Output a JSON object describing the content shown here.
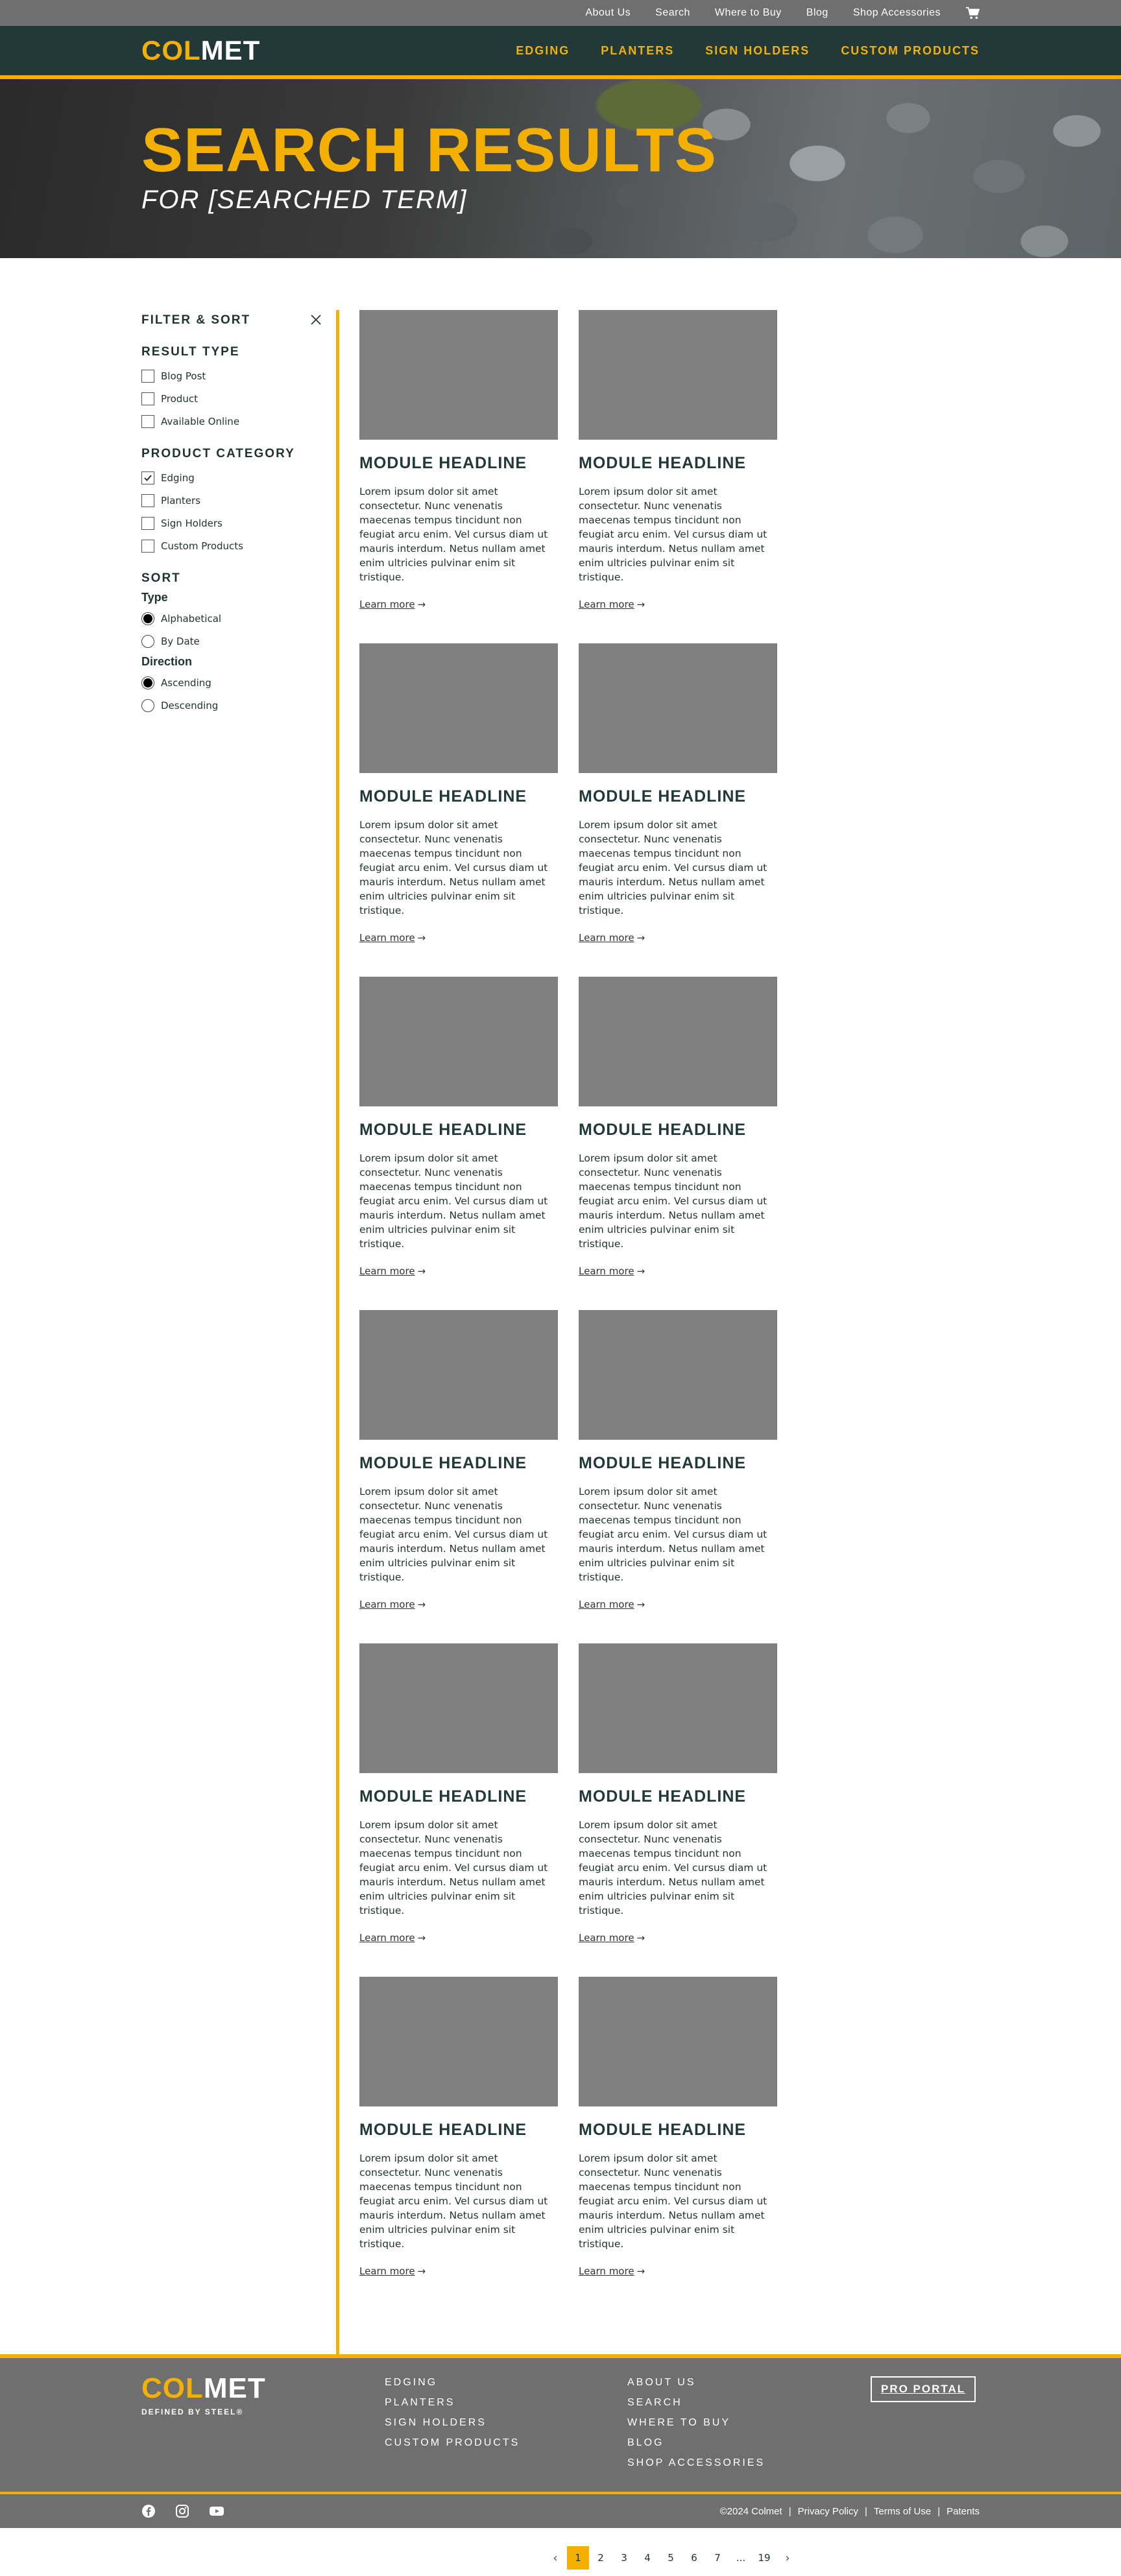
{
  "utility_nav": [
    "About Us",
    "Search",
    "Where to Buy",
    "Blog",
    "Shop Accessories"
  ],
  "brand": {
    "logo_part1": "COL",
    "logo_part2": "MET",
    "tagline": "DEFINED BY STEEL®"
  },
  "main_nav": [
    "EDGING",
    "PLANTERS",
    "SIGN HOLDERS",
    "CUSTOM PRODUCTS"
  ],
  "hero": {
    "title": "SEARCH RESULTS",
    "subtitle": "FOR [SEARCHED TERM]"
  },
  "filters": {
    "title": "FILTER & SORT",
    "result_type": {
      "title": "RESULT TYPE",
      "options": [
        {
          "label": "Blog Post",
          "checked": false
        },
        {
          "label": "Product",
          "checked": false
        },
        {
          "label": "Available Online",
          "checked": false
        }
      ]
    },
    "product_category": {
      "title": "PRODUCT CATEGORY",
      "options": [
        {
          "label": "Edging",
          "checked": true
        },
        {
          "label": "Planters",
          "checked": false
        },
        {
          "label": "Sign Holders",
          "checked": false
        },
        {
          "label": "Custom Products",
          "checked": false
        }
      ]
    },
    "sort": {
      "title": "SORT",
      "type_label": "Type",
      "type_options": [
        {
          "label": "Alphabetical",
          "selected": true
        },
        {
          "label": "By Date",
          "selected": false
        }
      ],
      "direction_label": "Direction",
      "direction_options": [
        {
          "label": "Ascending",
          "selected": true
        },
        {
          "label": "Descending",
          "selected": false
        }
      ]
    }
  },
  "results": [
    {
      "headline": "MODULE HEADLINE",
      "body": "Lorem ipsum dolor sit amet consectetur. Nunc venenatis maecenas tempus tincidunt non feugiat arcu enim. Vel cursus diam ut mauris interdum. Netus nullam amet enim ultricies pulvinar enim sit tristique.",
      "link": "Learn more"
    },
    {
      "headline": "MODULE HEADLINE",
      "body": "Lorem ipsum dolor sit amet consectetur. Nunc venenatis maecenas tempus tincidunt non feugiat arcu enim. Vel cursus diam ut mauris interdum. Netus nullam amet enim ultricies pulvinar enim sit tristique.",
      "link": "Learn more"
    },
    {
      "headline": "MODULE HEADLINE",
      "body": "Lorem ipsum dolor sit amet consectetur. Nunc venenatis maecenas tempus tincidunt non feugiat arcu enim. Vel cursus diam ut mauris interdum. Netus nullam amet enim ultricies pulvinar enim sit tristique.",
      "link": "Learn more"
    },
    {
      "headline": "MODULE HEADLINE",
      "body": "Lorem ipsum dolor sit amet consectetur. Nunc venenatis maecenas tempus tincidunt non feugiat arcu enim. Vel cursus diam ut mauris interdum. Netus nullam amet enim ultricies pulvinar enim sit tristique.",
      "link": "Learn more"
    },
    {
      "headline": "MODULE HEADLINE",
      "body": "Lorem ipsum dolor sit amet consectetur. Nunc venenatis maecenas tempus tincidunt non feugiat arcu enim. Vel cursus diam ut mauris interdum. Netus nullam amet enim ultricies pulvinar enim sit tristique.",
      "link": "Learn more"
    },
    {
      "headline": "MODULE HEADLINE",
      "body": "Lorem ipsum dolor sit amet consectetur. Nunc venenatis maecenas tempus tincidunt non feugiat arcu enim. Vel cursus diam ut mauris interdum. Netus nullam amet enim ultricies pulvinar enim sit tristique.",
      "link": "Learn more"
    },
    {
      "headline": "MODULE HEADLINE",
      "body": "Lorem ipsum dolor sit amet consectetur. Nunc venenatis maecenas tempus tincidunt non feugiat arcu enim. Vel cursus diam ut mauris interdum. Netus nullam amet enim ultricies pulvinar enim sit tristique.",
      "link": "Learn more"
    },
    {
      "headline": "MODULE HEADLINE",
      "body": "Lorem ipsum dolor sit amet consectetur. Nunc venenatis maecenas tempus tincidunt non feugiat arcu enim. Vel cursus diam ut mauris interdum. Netus nullam amet enim ultricies pulvinar enim sit tristique.",
      "link": "Learn more"
    },
    {
      "headline": "MODULE HEADLINE",
      "body": "Lorem ipsum dolor sit amet consectetur. Nunc venenatis maecenas tempus tincidunt non feugiat arcu enim. Vel cursus diam ut mauris interdum. Netus nullam amet enim ultricies pulvinar enim sit tristique.",
      "link": "Learn more"
    },
    {
      "headline": "MODULE HEADLINE",
      "body": "Lorem ipsum dolor sit amet consectetur. Nunc venenatis maecenas tempus tincidunt non feugiat arcu enim. Vel cursus diam ut mauris interdum. Netus nullam amet enim ultricies pulvinar enim sit tristique.",
      "link": "Learn more"
    },
    {
      "headline": "MODULE HEADLINE",
      "body": "Lorem ipsum dolor sit amet consectetur. Nunc venenatis maecenas tempus tincidunt non feugiat arcu enim. Vel cursus diam ut mauris interdum. Netus nullam amet enim ultricies pulvinar enim sit tristique.",
      "link": "Learn more"
    },
    {
      "headline": "MODULE HEADLINE",
      "body": "Lorem ipsum dolor sit amet consectetur. Nunc venenatis maecenas tempus tincidunt non feugiat arcu enim. Vel cursus diam ut mauris interdum. Netus nullam amet enim ultricies pulvinar enim sit tristique.",
      "link": "Learn more"
    }
  ],
  "pagination": {
    "pages": [
      "1",
      "2",
      "3",
      "4",
      "5",
      "6",
      "7",
      "...",
      "19"
    ],
    "current": "1"
  },
  "footer": {
    "col1": [
      "EDGING",
      "PLANTERS",
      "SIGN HOLDERS",
      "CUSTOM PRODUCTS"
    ],
    "col2": [
      "ABOUT US",
      "SEARCH",
      "WHERE TO BUY",
      "BLOG",
      "SHOP ACCESSORIES"
    ],
    "pro_portal": "PRO PORTAL",
    "copyright": "©2024 Colmet",
    "legal_links": [
      "Privacy Policy",
      "Terms of Use",
      "Patents"
    ],
    "socials": [
      "facebook-icon",
      "instagram-icon",
      "youtube-icon"
    ]
  },
  "colors": {
    "accent": "#f4b000",
    "header_bg": "#22393a",
    "utility_bg": "#6f6f6f",
    "placeholder": "#808080"
  }
}
